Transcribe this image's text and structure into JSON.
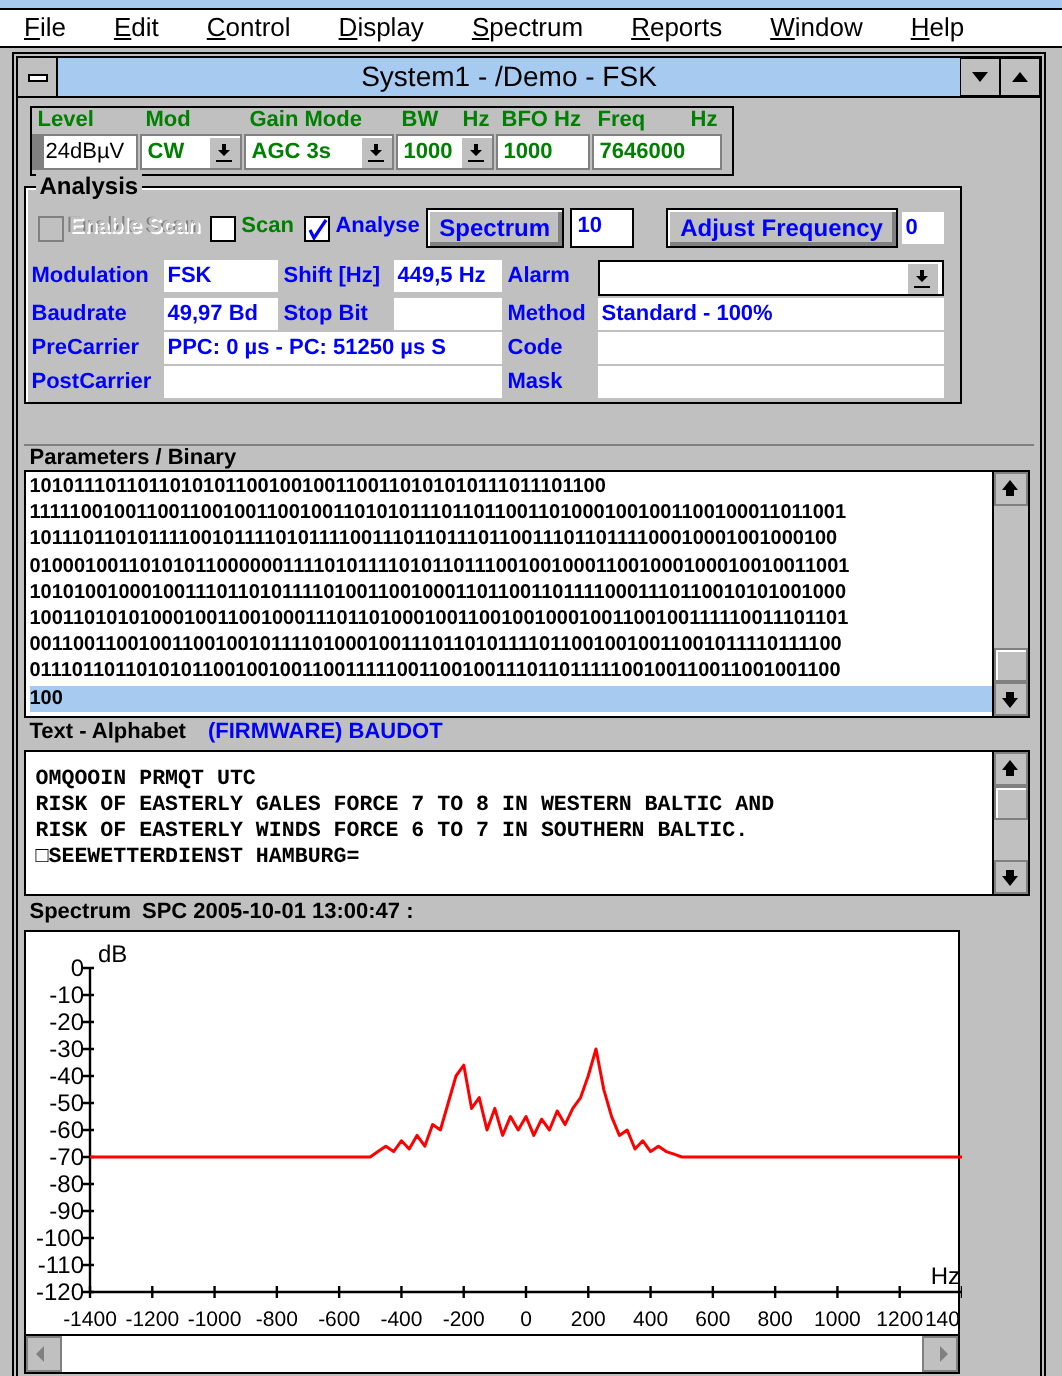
{
  "menu": [
    {
      "label": "File"
    },
    {
      "label": "Edit"
    },
    {
      "label": "Control"
    },
    {
      "label": "Display"
    },
    {
      "label": "Spectrum"
    },
    {
      "label": "Reports"
    },
    {
      "label": "Window"
    },
    {
      "label": "Help"
    }
  ],
  "window": {
    "title": "System1 - /Demo - FSK"
  },
  "receiver": [
    {
      "label": "Level",
      "value": "24dBµV",
      "kind": "level"
    },
    {
      "label": "Mod",
      "value": "CW",
      "kind": "dropdown"
    },
    {
      "label": "Gain Mode",
      "value": "AGC 3s",
      "kind": "dropdown"
    },
    {
      "label": "BW",
      "unit": "Hz",
      "value": "1000",
      "kind": "dropdown"
    },
    {
      "label": "BFO Hz",
      "value": "1000",
      "kind": "field"
    },
    {
      "label": "Freq",
      "unit": "Hz",
      "value": "7646000",
      "kind": "field"
    }
  ],
  "analysis": {
    "title": "Analysis",
    "checkboxes": [
      {
        "label": "Enable Scan",
        "checked": false,
        "disabled": true
      },
      {
        "label": "Scan",
        "checked": false,
        "disabled": false,
        "color": "#008000"
      },
      {
        "label": "Analyse",
        "checked": true,
        "disabled": false,
        "color": "#0000ff"
      }
    ],
    "spectrum_button": "Spectrum",
    "spectrum_value": "10",
    "adjust_button": "Adjust Frequency",
    "adjust_value": "0",
    "rows": [
      [
        {
          "label": "Modulation",
          "value": "FSK",
          "kind": "field"
        },
        {
          "label": "Shift [Hz]",
          "value": "449,5 Hz",
          "kind": "field"
        },
        {
          "label": "Alarm",
          "kind": "dropdown"
        }
      ],
      [
        {
          "label": "Baudrate",
          "value": "49,97 Bd",
          "kind": "field"
        },
        {
          "label": "Stop Bit",
          "kind": "field"
        },
        {
          "label": "Method",
          "value": "Standard - 100%",
          "kind": "field"
        }
      ],
      [
        {
          "label": "PreCarrier",
          "value": "PPC: 0 µs - PC: 51250 µs S",
          "kind": "field"
        },
        {
          "label": "Code",
          "kind": "field"
        }
      ],
      [
        {
          "label": "PostCarrier",
          "kind": "field"
        },
        {
          "label": "Mask",
          "kind": "field"
        }
      ]
    ]
  },
  "binary": {
    "title": "Parameters / Binary",
    "rows": [
      {
        "text": "10101110110110101011001001001100110101010111011101100",
        "selected": false
      },
      {
        "text": "111110010011001100100110010011010101110110110011010001001001100100011011001",
        "selected": false
      },
      {
        "text": "101110110101111001011110101111001110110111011001110110111100010001001000100",
        "selected": false
      },
      {
        "text": "010001001101010110000001111010111101011011100100100011001000100010010011001",
        "selected": false
      },
      {
        "text": "101010010001001110110101111010011001000110110011011110001110110010101001000",
        "selected": false
      },
      {
        "text": "100110101010001001100100011101101000100110010010001001100100111110011101101",
        "selected": false
      },
      {
        "text": "001100110010011001001011110100010011101101011110110010010011001011110111100",
        "selected": false
      },
      {
        "text": "011101101101010110010010011001111100110010011101101111100100110011001001100",
        "selected": false
      },
      {
        "text": "100",
        "selected": true
      }
    ]
  },
  "text": {
    "title": "Text - Alphabet",
    "alphabet": "(FIRMWARE) BAUDOT",
    "lines": [
      "OMQOOIN PRMQT UTC",
      "RISK OF EASTERLY GALES FORCE 7 TO 8 IN WESTERN BALTIC AND",
      "RISK OF EASTERLY WINDS FORCE 6 TO 7 IN SOUTHERN BALTIC.",
      "□SEEWETTERDIENST HAMBURG="
    ]
  },
  "spectrum": {
    "title": "Spectrum",
    "timestamp": "SPC 2005-10-01 13:00:47 :",
    "cut_tick_label": "140",
    "chart_data": {
      "type": "line",
      "xlabel": "Hz",
      "ylabel": "dB",
      "xlim": [
        -1400,
        1400
      ],
      "ylim": [
        -120,
        0
      ],
      "xticks": [
        -1400,
        -1200,
        -1000,
        -800,
        -600,
        -400,
        -200,
        0,
        200,
        400,
        600,
        800,
        1000,
        1200
      ],
      "yticks": [
        0,
        -10,
        -20,
        -30,
        -40,
        -50,
        -60,
        -70,
        -80,
        -90,
        -100,
        -110,
        -120
      ],
      "x": [
        -1400,
        -525,
        -500,
        -475,
        -450,
        -425,
        -400,
        -375,
        -350,
        -325,
        -300,
        -275,
        -250,
        -225,
        -200,
        -175,
        -150,
        -125,
        -100,
        -75,
        -50,
        -25,
        0,
        25,
        50,
        75,
        100,
        125,
        150,
        175,
        200,
        225,
        250,
        275,
        300,
        325,
        350,
        375,
        400,
        425,
        450,
        475,
        500,
        525,
        1400
      ],
      "series": [
        {
          "color": "#ff0000",
          "values": [
            -70,
            -70,
            -70,
            -68,
            -66,
            -68,
            -64,
            -67,
            -62,
            -66,
            -58,
            -60,
            -50,
            -40,
            -36,
            -52,
            -48,
            -60,
            -52,
            -62,
            -55,
            -60,
            -55,
            -62,
            -56,
            -60,
            -53,
            -58,
            -52,
            -48,
            -40,
            -30,
            -45,
            -55,
            -62,
            -60,
            -67,
            -64,
            -68,
            -66,
            -68,
            -69,
            -70,
            -70,
            -70
          ]
        }
      ]
    }
  }
}
